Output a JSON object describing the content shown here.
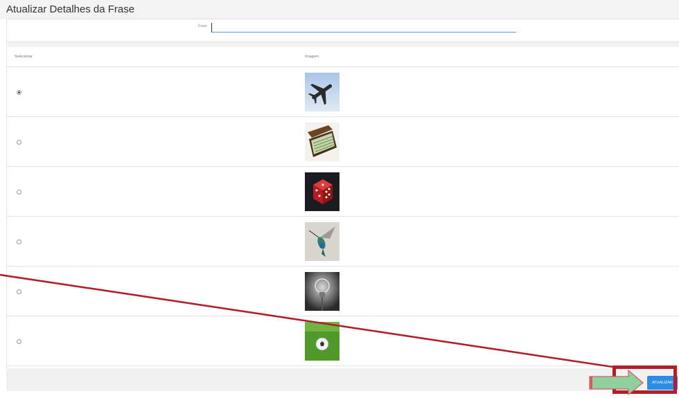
{
  "header": {
    "title": "Atualizar Detalhes da Frase"
  },
  "form": {
    "frase_label": "Frase",
    "frase_value": ""
  },
  "table": {
    "columns": [
      "Selecionar",
      "Imagem"
    ],
    "rows": [
      {
        "selected": true,
        "image": "airplane-image"
      },
      {
        "selected": false,
        "image": "money-briefcase-image"
      },
      {
        "selected": false,
        "image": "red-dice-image"
      },
      {
        "selected": false,
        "image": "hummingbird-image"
      },
      {
        "selected": false,
        "image": "light-bulb-image"
      },
      {
        "selected": false,
        "image": "soccer-ball-image"
      }
    ]
  },
  "footer": {
    "update_label": "ATUALIZAR"
  },
  "annotation": {
    "highlight_color": "#b0202a",
    "arrow_fill": "#8fd19e",
    "line_color": "#b0202a"
  }
}
